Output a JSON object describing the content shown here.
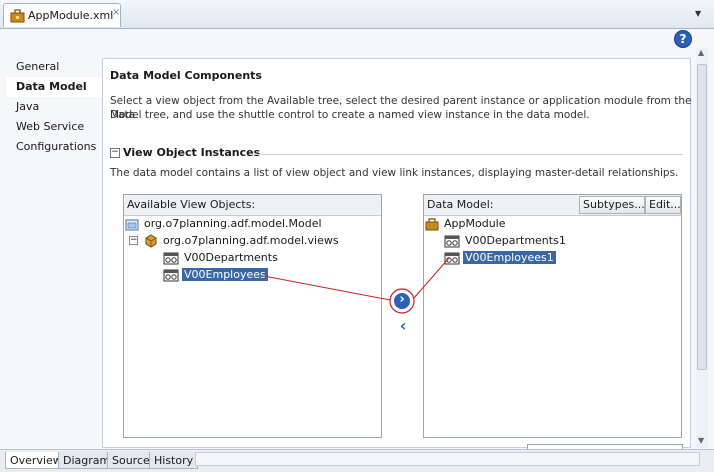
{
  "editor_tab": {
    "title": "AppModule.xml",
    "close": "×"
  },
  "nav": {
    "items": [
      {
        "label": "General",
        "selected": false
      },
      {
        "label": "Data Model",
        "selected": true
      },
      {
        "label": "Java",
        "selected": false
      },
      {
        "label": "Web Service",
        "selected": false
      },
      {
        "label": "Configurations",
        "selected": false
      }
    ]
  },
  "help": {
    "symbol": "?"
  },
  "section": {
    "title": "Data Model Components",
    "description_line1": "Select a view object from the Available tree, select the desired parent instance or application module from the Data",
    "description_line2": "Model tree, and use the shuttle control to create a named view instance in the data model.",
    "instances_title": "View Object Instances",
    "instances_toggle": "−",
    "instances_description": "The data model contains a list of view object and view link instances, displaying master-detail relationships."
  },
  "available": {
    "header": "Available View Objects:",
    "nodes": [
      {
        "label": "org.o7planning.adf.model.Model",
        "icon": "project-icon"
      },
      {
        "label": "org.o7planning.adf.model.views",
        "icon": "package-icon",
        "expander": "−"
      },
      {
        "label": "V00Departments",
        "icon": "view-object-icon"
      },
      {
        "label": "V00Employees",
        "icon": "view-object-icon",
        "selected": true
      }
    ]
  },
  "data_model": {
    "header": "Data Model:",
    "subtypes_label": "Subtypes...",
    "edit_label": "Edit...",
    "nodes": [
      {
        "label": "AppModule",
        "icon": "app-module-icon"
      },
      {
        "label": "V00Departments1",
        "icon": "view-instance-icon"
      },
      {
        "label": "V00Employees1",
        "icon": "view-instance-icon",
        "selected": true
      }
    ]
  },
  "shuttle": {
    "add": "›",
    "remove": "‹"
  },
  "bottom_tabs": [
    {
      "label": "Overview",
      "selected": true
    },
    {
      "label": "Diagram",
      "selected": false
    },
    {
      "label": "Source",
      "selected": false
    },
    {
      "label": "History",
      "selected": false
    }
  ],
  "colors": {
    "selection": "#3966a5",
    "accent_red": "#cc1f1f",
    "link_blue": "#2b62b8"
  }
}
